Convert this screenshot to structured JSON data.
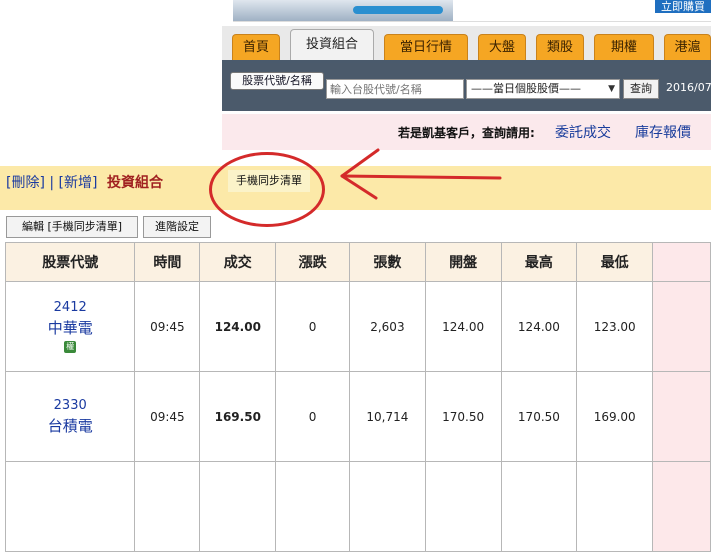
{
  "banner": {
    "button_label": "立即購買"
  },
  "nav": {
    "tabs": [
      "首頁",
      "投資組合",
      "當日行情",
      "大盤",
      "類股",
      "期權",
      "港滬"
    ],
    "active": "投資組合"
  },
  "search": {
    "stock_button": "股票代號/名稱",
    "placeholder": "輸入台股代號/名稱",
    "select_value": "——當日個股股價——",
    "query_button": "查詢",
    "date": "2016/07"
  },
  "notice": {
    "text": "若是凱基客戶，查詢請用:",
    "link1": "委託成交",
    "link2": "庫存報價"
  },
  "portfolio": {
    "links": "[刪除] | [新增]",
    "title": "投資組合",
    "sync_button": "手機同步清單"
  },
  "actions": {
    "edit_button": "編輯 [手機同步清單]",
    "advanced_button": "進階設定"
  },
  "table": {
    "headers": [
      "股票代號",
      "時間",
      "成交",
      "漲跌",
      "張數",
      "開盤",
      "最高",
      "最低"
    ],
    "rows": [
      {
        "code": "2412",
        "name": "中華電",
        "badge": "權",
        "time": "09:45",
        "price": "124.00",
        "change": "0",
        "volume": "2,603",
        "open": "124.00",
        "high": "124.00",
        "low": "123.00"
      },
      {
        "code": "2330",
        "name": "台積電",
        "time": "09:45",
        "price": "169.50",
        "change": "0",
        "volume": "10,714",
        "open": "170.50",
        "high": "170.50",
        "low": "169.00"
      }
    ]
  },
  "colors": {
    "accent_orange": "#f5a623",
    "annotation_red": "#d42a2a",
    "link_blue": "#1a3aa0",
    "up_red": "#c81e1e",
    "down_green": "#1e8a1e"
  }
}
